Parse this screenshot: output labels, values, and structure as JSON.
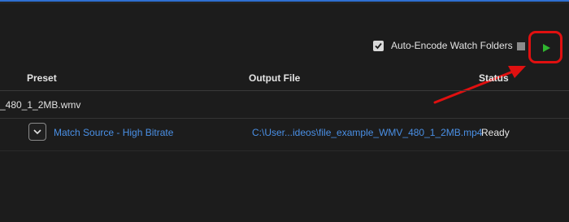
{
  "toolbar": {
    "auto_encode_label": "Auto-Encode Watch Folders",
    "auto_encode_checked": true,
    "accent_color": "#2f6fd0",
    "play_color": "#2fb52f",
    "highlight_color": "#e01010"
  },
  "queue": {
    "columns": {
      "preset": "Preset",
      "output": "Output File",
      "status": "Status"
    },
    "source_file": "_480_1_2MB.wmv",
    "items": [
      {
        "preset": "Match Source - High Bitrate",
        "output": "C:\\User...ideos\\file_example_WMV_480_1_2MB.mp4",
        "status": "Ready"
      }
    ]
  }
}
